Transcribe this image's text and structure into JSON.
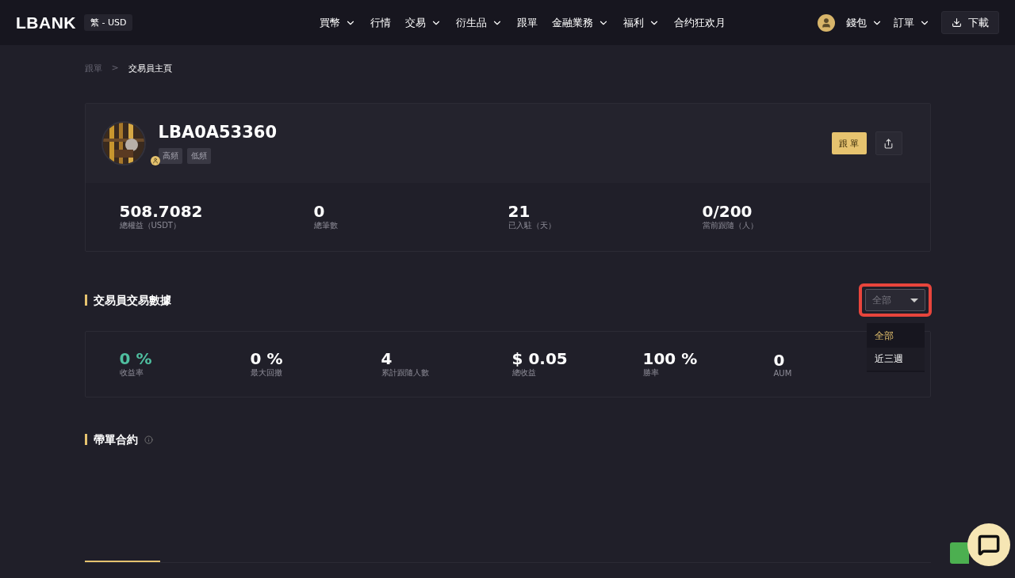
{
  "header": {
    "logo": "LBANK",
    "locale": "繁 - USD",
    "nav": [
      {
        "label": "買幣",
        "dropdown": true
      },
      {
        "label": "行情",
        "dropdown": false
      },
      {
        "label": "交易",
        "dropdown": true
      },
      {
        "label": "衍生品",
        "dropdown": true
      },
      {
        "label": "跟單",
        "dropdown": false
      },
      {
        "label": "金融業務",
        "dropdown": true
      },
      {
        "label": "福利",
        "dropdown": true
      },
      {
        "label": "合约狂欢月",
        "dropdown": false
      }
    ],
    "right": [
      {
        "label": "錢包",
        "dropdown": true
      },
      {
        "label": "訂單",
        "dropdown": true
      }
    ],
    "download": "下載"
  },
  "breadcrumb": [
    {
      "label": "跟單",
      "current": false
    },
    {
      "label": "交易員主頁",
      "current": true
    }
  ],
  "breadcrumb_separator": ">",
  "profile": {
    "name": "LBA0A53360",
    "tags": [
      "高頻",
      "低頻"
    ],
    "follow_button": "跟 單",
    "stats": [
      {
        "value": "508.7082",
        "label": "總權益（USDT）"
      },
      {
        "value": "0",
        "label": "總筆數"
      },
      {
        "value": "21",
        "label": "已入駐（天）"
      },
      {
        "value": "0/200",
        "label": "當前跟隨（人）"
      }
    ]
  },
  "trading_data": {
    "title": "交易員交易數據",
    "period_select": {
      "value": "全部",
      "options": [
        {
          "label": "全部",
          "selected": true
        },
        {
          "label": "近三週",
          "selected": false
        }
      ]
    },
    "stats": [
      {
        "value": "0 %",
        "label": "收益率",
        "positive": true
      },
      {
        "value": "0 %",
        "label": "最大回撤",
        "positive": false
      },
      {
        "value": "4",
        "label": "累計跟隨人數",
        "positive": false
      },
      {
        "value": "$ 0.05",
        "label": "總收益",
        "positive": false
      },
      {
        "value": "100 %",
        "label": "勝率",
        "positive": false
      },
      {
        "value": "0",
        "label": "AUM",
        "positive": false
      }
    ]
  },
  "contracts": {
    "title": "帶單合約"
  }
}
